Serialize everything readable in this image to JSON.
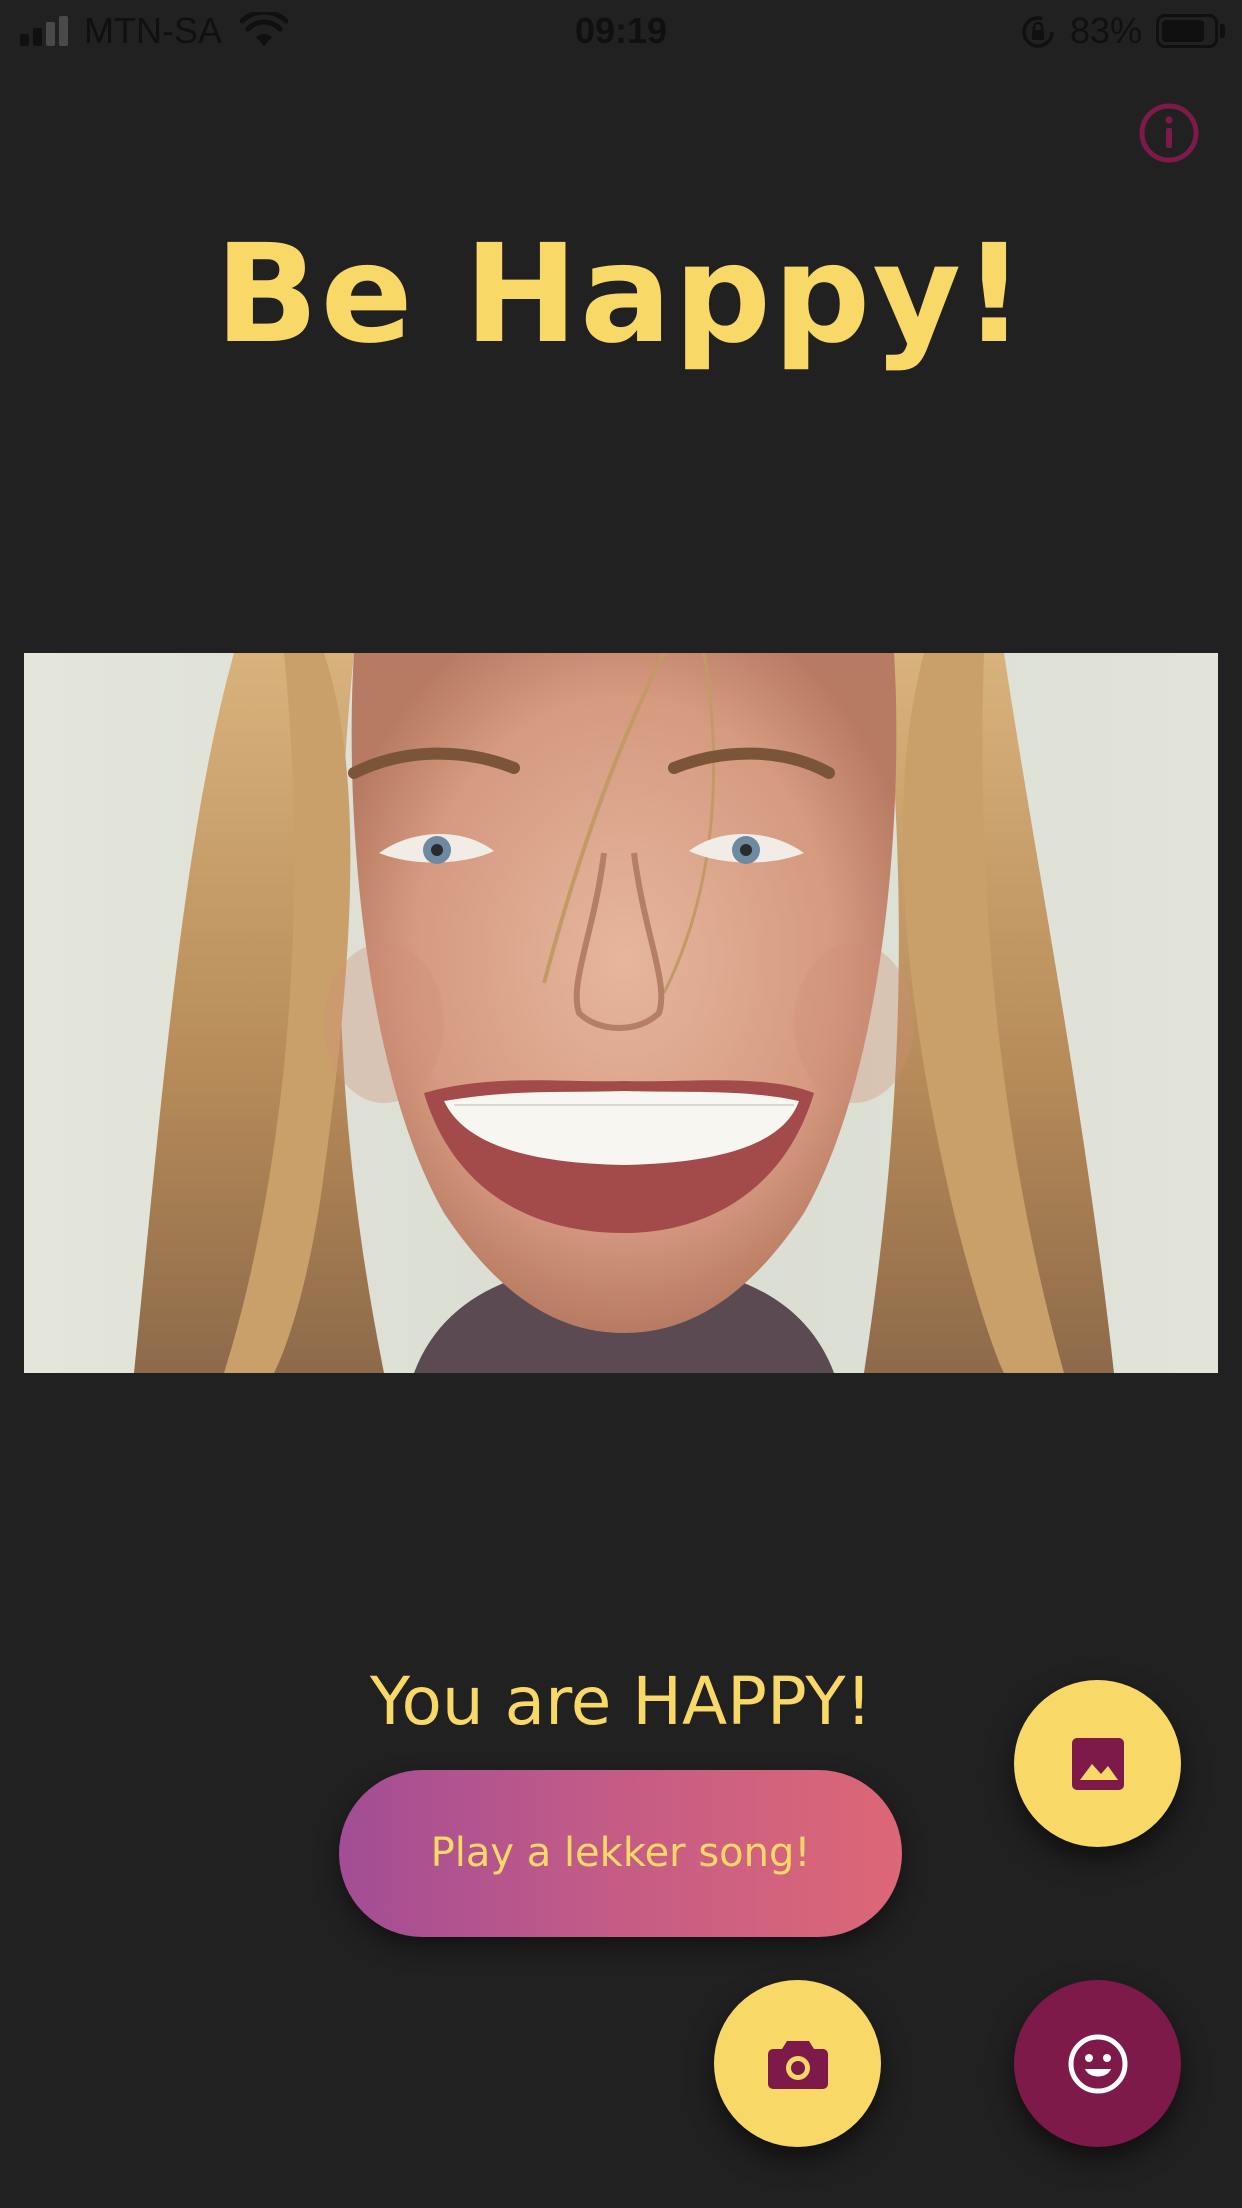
{
  "status_bar": {
    "carrier": "MTN-SA",
    "time": "09:19",
    "battery_percent_label": "83%",
    "battery_level": 0.83,
    "signal_bars_active": 2,
    "signal_bars_total": 4
  },
  "header": {
    "info_icon": "info-circle-icon"
  },
  "main": {
    "headline": "Be Happy!",
    "photo_subject": "smiling woman with long blonde hair",
    "result_text": "You are HAPPY!",
    "play_button_label": "Play a lekker song!"
  },
  "actions": {
    "gallery_icon": "image-icon",
    "camera_icon": "camera-icon",
    "emotion_icon": "smiley-face-icon"
  },
  "colors": {
    "background": "#212121",
    "accent_yellow": "#f8d866",
    "accent_maroon": "#7d1a4a",
    "gradient_start": "#a24d95",
    "gradient_end": "#dd6776"
  }
}
